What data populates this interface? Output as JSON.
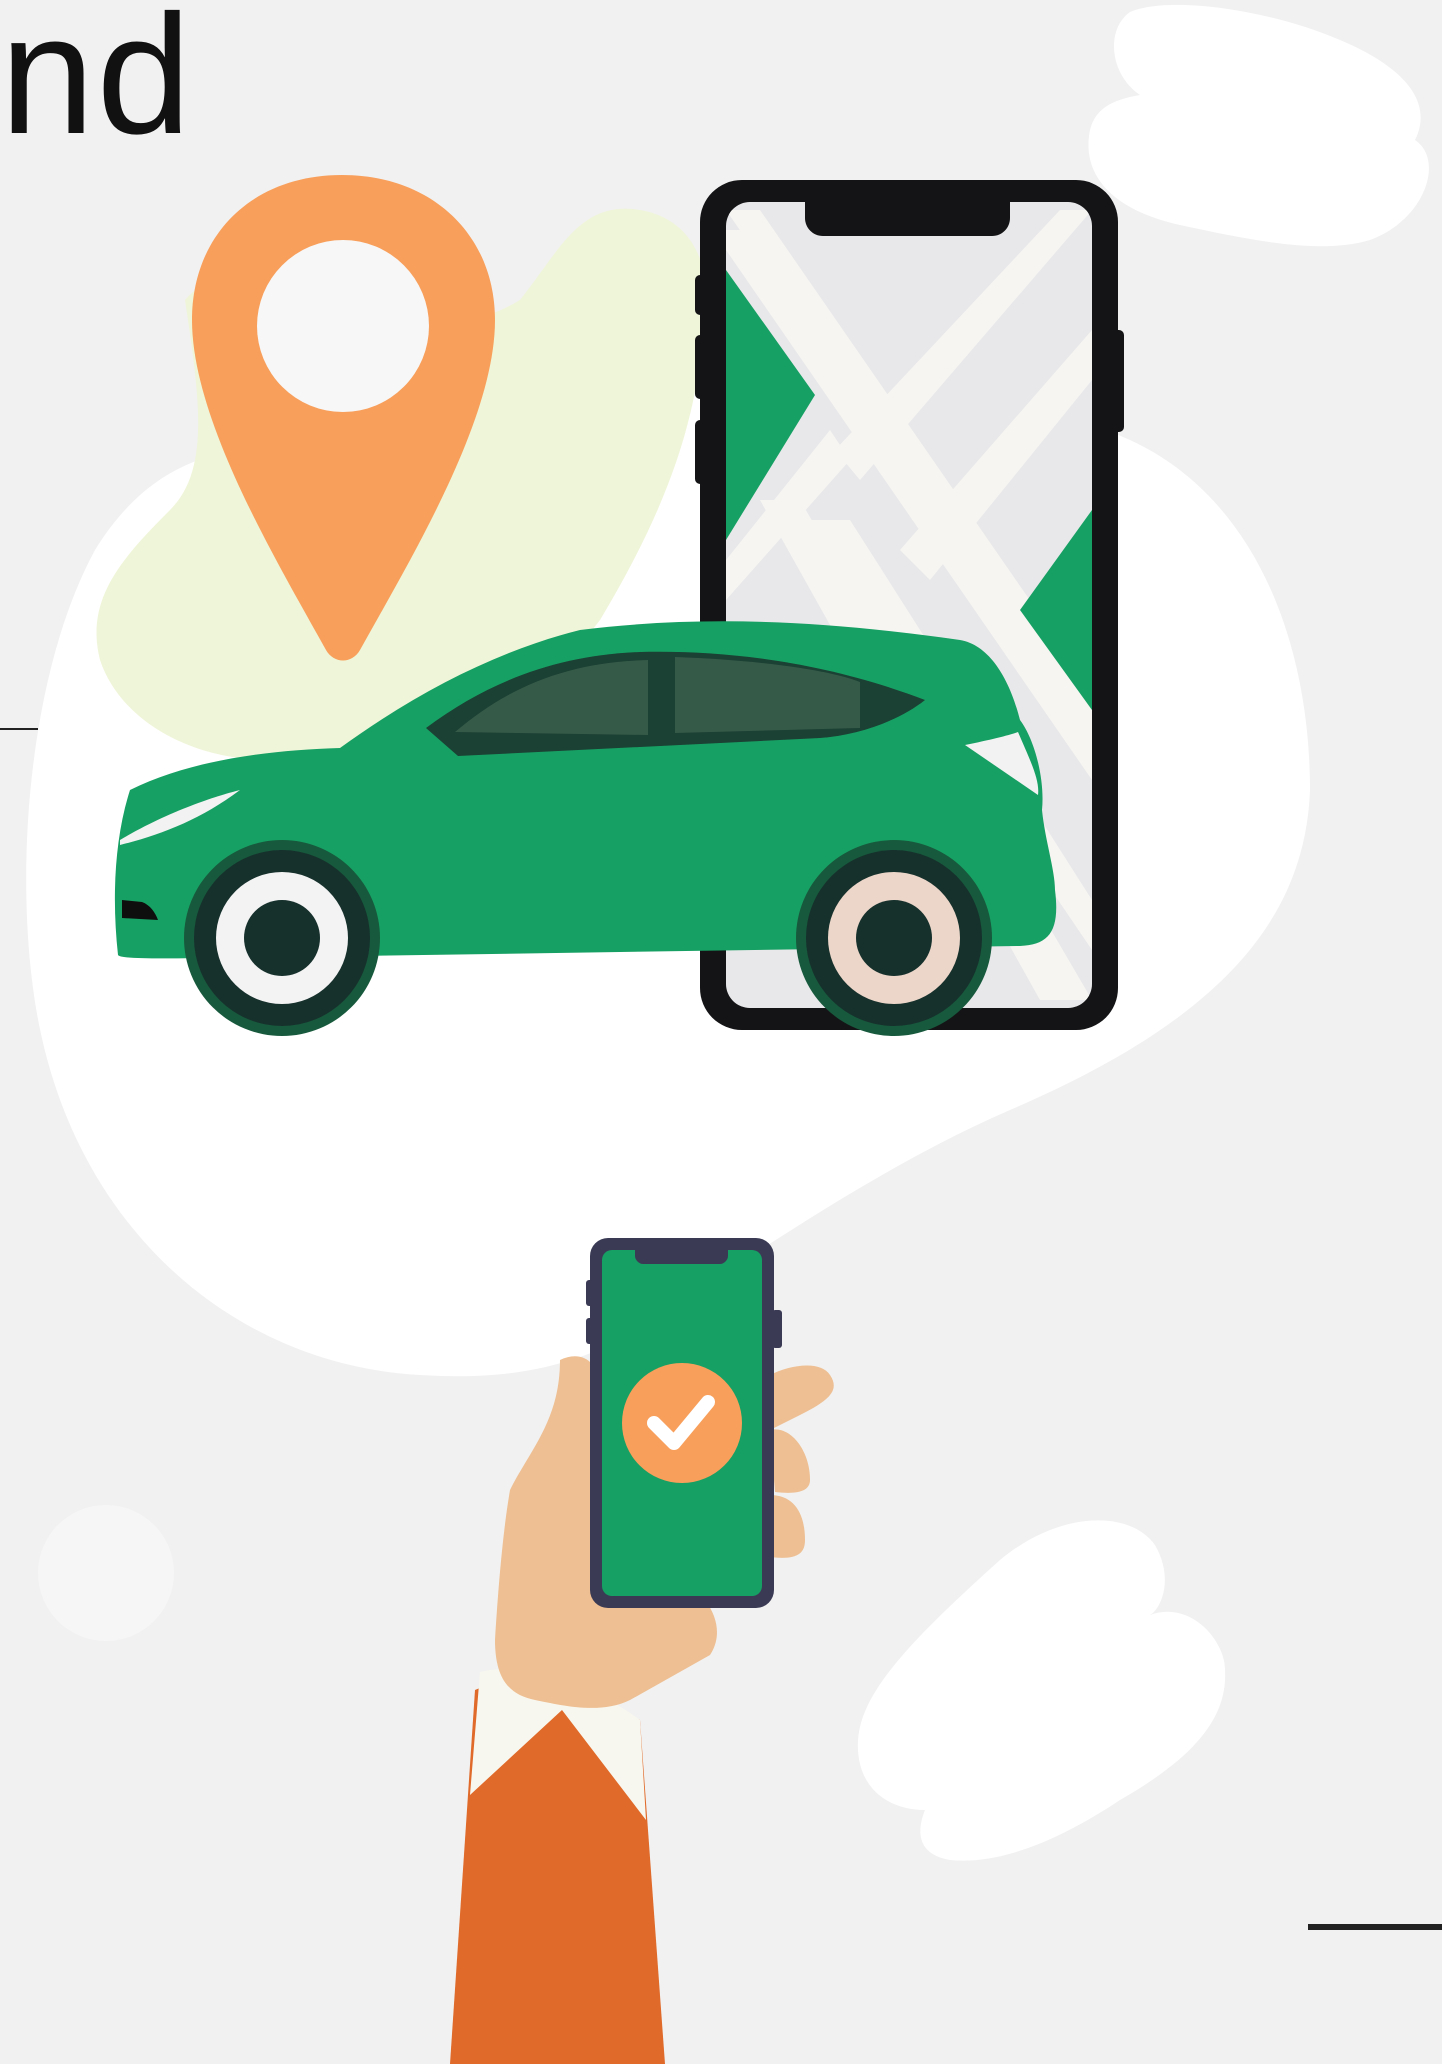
{
  "heading": {
    "partial_text": "nd"
  },
  "colors": {
    "background": "#f1f1f1",
    "blob": "#ffffff",
    "accent_green": "#17a063",
    "pin_orange": "#f89f5b",
    "sleeve_orange": "#e06a29",
    "light_green_blob": "#eff5d8",
    "phone_frame": "#141416",
    "small_phone_frame": "#3a3a55",
    "skin": "#eebf92"
  },
  "illustration": {
    "pin": "location-pin-icon",
    "large_phone": "smartphone-map-icon",
    "car": "hatchback-car-icon",
    "hand_phone": "hand-holding-phone-icon",
    "check": "checkmark-icon"
  }
}
